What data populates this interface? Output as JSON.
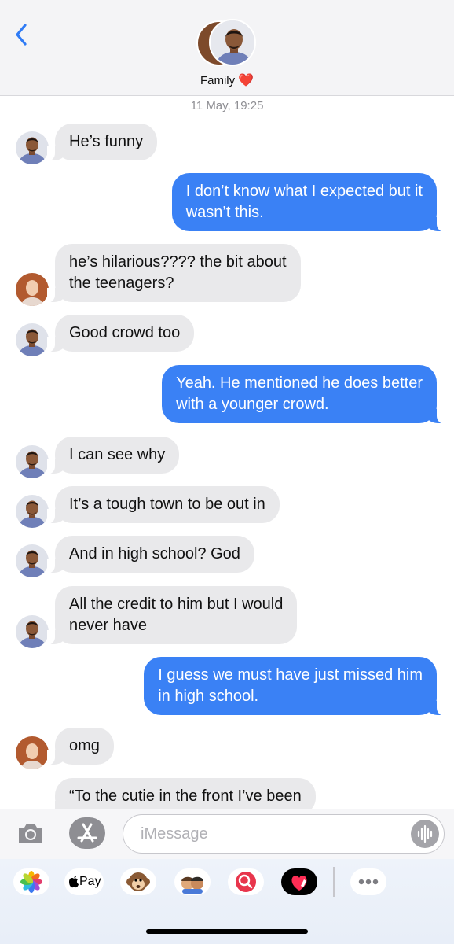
{
  "header": {
    "title": "Family",
    "heart": "❤️"
  },
  "timestamp": "11 May, 19:25",
  "messages": [
    {
      "text": "He’s funny"
    },
    {
      "text": "I don’t know what I expected but it\nwasn’t this."
    },
    {
      "text": "he’s hilarious???? the bit about\nthe teenagers?"
    },
    {
      "text": "Good crowd too"
    },
    {
      "text": "Yeah. He mentioned he does better\nwith a younger crowd."
    },
    {
      "text": "I can see why"
    },
    {
      "text": "It’s a tough town to be out in"
    },
    {
      "text": "And in high school? God"
    },
    {
      "text": "All the credit to him but I would\nnever have"
    },
    {
      "text": "I guess we must have just missed him\nin high school."
    },
    {
      "text": "omg"
    },
    {
      "text": "“To the cutie in the front I’ve been"
    }
  ],
  "input": {
    "placeholder": "iMessage"
  },
  "apps": {
    "apple_pay_label": "Pay"
  },
  "colors": {
    "accent": "#3a81f5",
    "incoming_bubble": "#e9e9eb",
    "heart": "#e3262e"
  },
  "icons": {
    "back": "chevron-left-icon",
    "camera": "camera-icon",
    "app_store": "app-store-icon",
    "audio": "waveform-icon",
    "photos": "photos-icon",
    "memoji": "monkey-icon",
    "memoji_stickers": "memoji-stickers-icon",
    "search": "image-search-icon",
    "digital_touch": "digital-touch-icon",
    "more": "more-icon"
  }
}
